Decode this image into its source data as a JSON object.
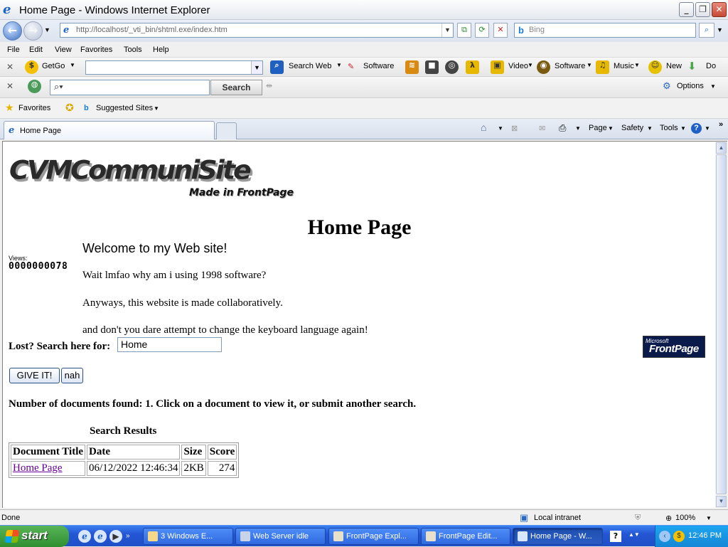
{
  "window": {
    "title": "Home Page - Windows Internet Explorer"
  },
  "address": {
    "url": "http://localhost/_vti_bin/shtml.exe/index.htm",
    "search_placeholder": "Bing"
  },
  "menu": [
    "File",
    "Edit",
    "View",
    "Favorites",
    "Tools",
    "Help"
  ],
  "toolbar1": {
    "getgo": "GetGo",
    "search_web": "Search Web",
    "software": "Software",
    "video": "Video",
    "software2": "Software",
    "music": "Music",
    "new": "New",
    "more": "Do"
  },
  "toolbar2": {
    "search_button": "Search",
    "options": "Options"
  },
  "favbar": {
    "favorites": "Favorites",
    "suggested": "Suggested Sites"
  },
  "tab": {
    "label": "Home Page"
  },
  "commandbar": {
    "page": "Page",
    "safety": "Safety",
    "tools": "Tools"
  },
  "page": {
    "logo": "CVMCommuniSite",
    "logo_sub": "Made in FrontPage",
    "heading": "Home Page",
    "views_label": "Views:",
    "views_value": "0000000078",
    "welcome": "Welcome to my Web site!",
    "line1": "Wait lmfao why am i using 1998 software?",
    "line2": "Anyways, this website is made collaboratively.",
    "line3": "and don't you dare attempt to change the keyboard language again!",
    "search_label": "Lost? Search here for:",
    "search_value": "Home",
    "submit_label": "GIVE IT!",
    "reset_label": "nah",
    "fp_badge_ms": "Microsoft",
    "fp_badge": "FrontPage",
    "found_text": "Number of documents found: 1. Click on a document to view it, or submit another search.",
    "results_heading": "Search Results",
    "columns": [
      "Document Title",
      "Date",
      "Size",
      "Score"
    ],
    "rows": [
      {
        "title": "Home Page",
        "date": "06/12/2022 12:46:34",
        "size": "2KB",
        "score": "274"
      }
    ]
  },
  "status": {
    "text": "Done",
    "zone": "Local intranet",
    "zoom": "100%"
  },
  "taskbar": {
    "start": "start",
    "tasks": [
      "3 Windows E...",
      "Web Server idle",
      "FrontPage Expl...",
      "FrontPage Edit...",
      "Home Page - W..."
    ],
    "clock": "12:46 PM"
  },
  "colors": {
    "link_visited": "#660099",
    "taskbar": "#2456d4",
    "start": "#3c9a3c"
  }
}
